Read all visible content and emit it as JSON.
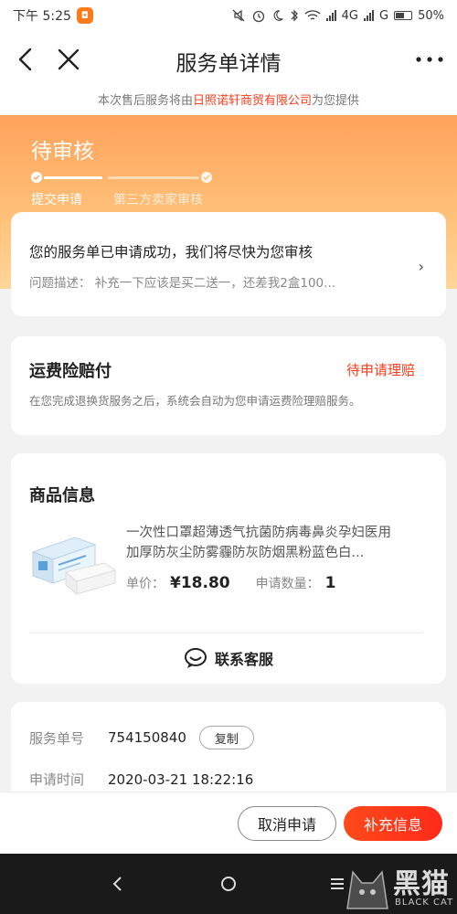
{
  "status_bar": {
    "time": "下午 5:25",
    "network": "4G",
    "carrier_g": "G",
    "battery": "50%"
  },
  "nav": {
    "title": "服务单详情"
  },
  "provider": {
    "prefix": "本次售后服务将由",
    "shop": "日照诺轩商贸有限公司",
    "suffix": "为您提供"
  },
  "status": {
    "title": "待审核",
    "steps": [
      {
        "label": "提交申请",
        "done": true
      },
      {
        "label": "第三方卖家审核",
        "done": false
      }
    ]
  },
  "apply": {
    "message": "您的服务单已申请成功，我们将尽快为您审核",
    "description": "问题描述：  补充一下应该是买二送一，还差我2盒100...",
    "arrow": "›"
  },
  "insurance": {
    "title": "运费险赔付",
    "status": "待申请理赔",
    "description": "在您完成退换货服务之后，系统会自动为您申请运费险理赔服务。"
  },
  "goods": {
    "section_title": "商品信息",
    "name": "一次性口罩超薄透气抗菌防病毒鼻炎孕妇医用加厚防灰尘防雾霾防灰防烟黑粉蓝色白...",
    "price_label": "单价：",
    "price": "¥18.80",
    "qty_label": "申请数量：",
    "qty": "1",
    "contact_label": "联系客服"
  },
  "service_info": {
    "order_no_label": "服务单号",
    "order_no": "754150840",
    "copy_label": "复制",
    "time_label": "申请时间",
    "time": "2020-03-21 18:22:16"
  },
  "actions": {
    "cancel_label": "取消申请",
    "supplement_label": "补充信息"
  },
  "watermark": {
    "cn": "黑猫",
    "en": "BLACK CAT"
  },
  "colors": {
    "accent_red": "#ff3a1a",
    "header_orange": "#ffa25b"
  }
}
